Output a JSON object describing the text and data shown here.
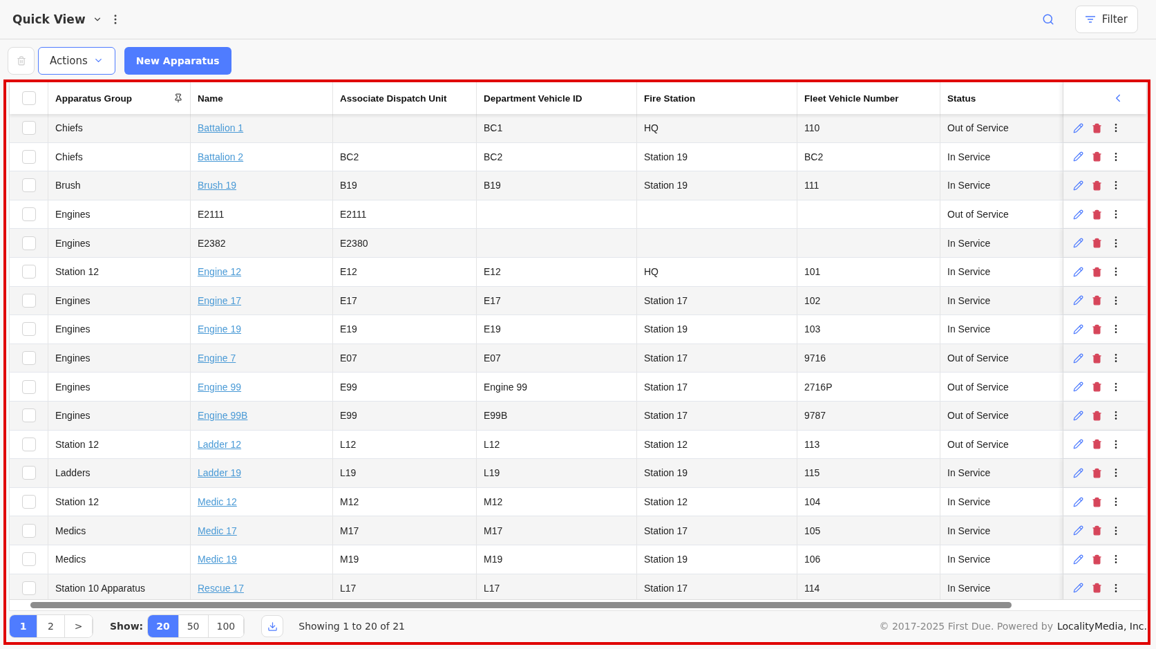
{
  "header": {
    "title": "Quick View",
    "filter_label": "Filter"
  },
  "toolbar": {
    "actions_label": "Actions",
    "new_label": "New Apparatus"
  },
  "table": {
    "columns": [
      "Apparatus Group",
      "Name",
      "Associate Dispatch Unit",
      "Department Vehicle ID",
      "Fire Station",
      "Fleet Vehicle Number",
      "Status"
    ],
    "all_checked": false,
    "rows": [
      {
        "checked": false,
        "group": "Chiefs",
        "name": "Battalion 1",
        "link": true,
        "unit": "",
        "vehicle_id": "BC1",
        "station": "HQ",
        "fleet": "110",
        "status": "Out of Service"
      },
      {
        "checked": false,
        "group": "Chiefs",
        "name": "Battalion 2",
        "link": true,
        "unit": "BC2",
        "vehicle_id": "BC2",
        "station": "Station 19",
        "fleet": "BC2",
        "status": "In Service"
      },
      {
        "checked": false,
        "group": "Brush",
        "name": "Brush 19",
        "link": true,
        "unit": "B19",
        "vehicle_id": "B19",
        "station": "Station 19",
        "fleet": "111",
        "status": "In Service"
      },
      {
        "checked": false,
        "group": "Engines",
        "name": "E2111",
        "link": false,
        "unit": "E2111",
        "vehicle_id": "",
        "station": "",
        "fleet": "",
        "status": "Out of Service"
      },
      {
        "checked": false,
        "group": "Engines",
        "name": "E2382",
        "link": false,
        "unit": "E2380",
        "vehicle_id": "",
        "station": "",
        "fleet": "",
        "status": "In Service"
      },
      {
        "checked": false,
        "group": "Station 12",
        "name": "Engine 12",
        "link": true,
        "unit": "E12",
        "vehicle_id": "E12",
        "station": "HQ",
        "fleet": "101",
        "status": "In Service"
      },
      {
        "checked": false,
        "group": "Engines",
        "name": "Engine 17",
        "link": true,
        "unit": "E17",
        "vehicle_id": "E17",
        "station": "Station 17",
        "fleet": "102",
        "status": "In Service"
      },
      {
        "checked": false,
        "group": "Engines",
        "name": "Engine 19",
        "link": true,
        "unit": "E19",
        "vehicle_id": "E19",
        "station": "Station 19",
        "fleet": "103",
        "status": "In Service"
      },
      {
        "checked": false,
        "group": "Engines",
        "name": "Engine 7",
        "link": true,
        "unit": "E07",
        "vehicle_id": "E07",
        "station": "Station 17",
        "fleet": "9716",
        "status": "Out of Service"
      },
      {
        "checked": false,
        "group": "Engines",
        "name": "Engine 99",
        "link": true,
        "unit": "E99",
        "vehicle_id": "Engine 99",
        "station": "Station 17",
        "fleet": "2716P",
        "status": "Out of Service"
      },
      {
        "checked": false,
        "group": "Engines",
        "name": "Engine 99B",
        "link": true,
        "unit": "E99",
        "vehicle_id": "E99B",
        "station": "Station 17",
        "fleet": "9787",
        "status": "Out of Service"
      },
      {
        "checked": false,
        "group": "Station 12",
        "name": "Ladder 12",
        "link": true,
        "unit": "L12",
        "vehicle_id": "L12",
        "station": "Station 12",
        "fleet": "113",
        "status": "Out of Service"
      },
      {
        "checked": false,
        "group": "Ladders",
        "name": "Ladder 19",
        "link": true,
        "unit": "L19",
        "vehicle_id": "L19",
        "station": "Station 19",
        "fleet": "115",
        "status": "In Service"
      },
      {
        "checked": false,
        "group": "Station 12",
        "name": "Medic 12",
        "link": true,
        "unit": "M12",
        "vehicle_id": "M12",
        "station": "Station 12",
        "fleet": "104",
        "status": "In Service"
      },
      {
        "checked": false,
        "group": "Medics",
        "name": "Medic 17",
        "link": true,
        "unit": "M17",
        "vehicle_id": "M17",
        "station": "Station 17",
        "fleet": "105",
        "status": "In Service"
      },
      {
        "checked": false,
        "group": "Medics",
        "name": "Medic 19",
        "link": true,
        "unit": "M19",
        "vehicle_id": "M19",
        "station": "Station 19",
        "fleet": "106",
        "status": "In Service"
      },
      {
        "checked": false,
        "group": "Station 10 Apparatus",
        "name": "Rescue 17",
        "link": true,
        "unit": "L17",
        "vehicle_id": "L17",
        "station": "Station 17",
        "fleet": "114",
        "status": "In Service"
      }
    ]
  },
  "pagination": {
    "pages": [
      {
        "label": "1",
        "selected": true
      },
      {
        "label": "2",
        "selected": false
      }
    ],
    "next": ">",
    "show_label": "Show:",
    "sizes": [
      {
        "label": "20",
        "selected": true
      },
      {
        "label": "50",
        "selected": false
      },
      {
        "label": "100",
        "selected": false
      }
    ],
    "summary": "Showing 1 to 20 of 21"
  },
  "footer": {
    "copyright": "© 2017-2025 First Due. Powered by",
    "company": "LocalityMedia, Inc."
  }
}
